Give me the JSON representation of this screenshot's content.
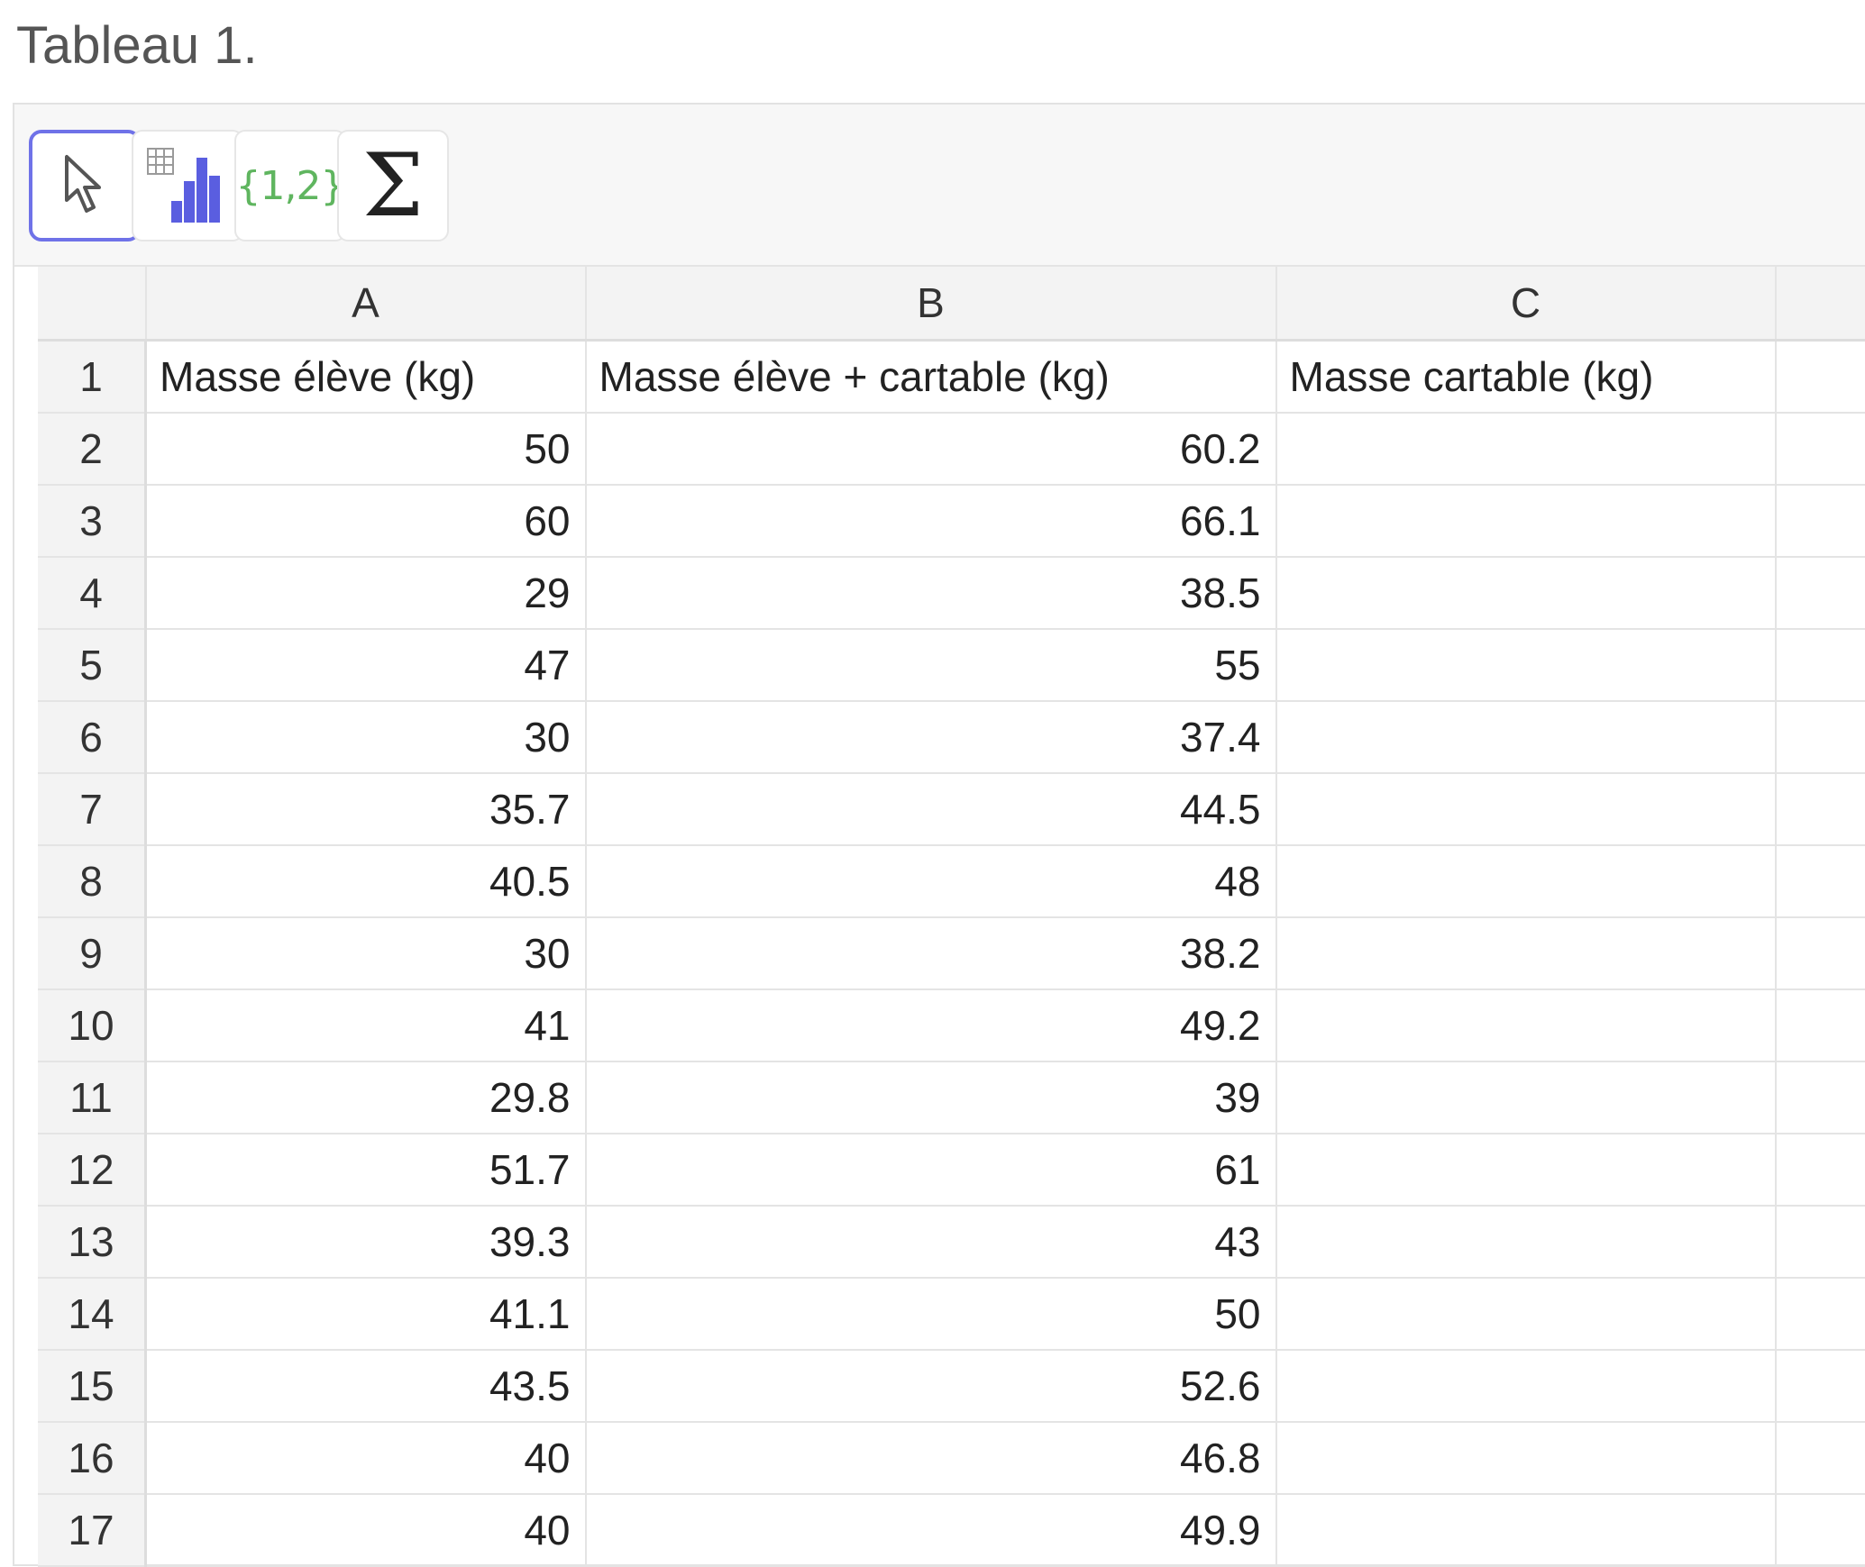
{
  "page_title": "Tableau 1.",
  "toolbar": {
    "tools": [
      {
        "name": "select",
        "icon": "cursor-arrow-icon",
        "active": true
      },
      {
        "name": "one-variable-analysis",
        "icon": "bar-chart-icon"
      },
      {
        "name": "create-list",
        "icon": "list-braces-icon",
        "label": "{1,2}"
      },
      {
        "name": "sum",
        "icon": "sigma-icon",
        "label": "Σ"
      }
    ]
  },
  "colors": {
    "active_tool_border": "#6f72e8",
    "bar_chart": "#5a5ee0",
    "list_label": "#5fb55f",
    "header_bg": "#f3f3f3",
    "grid_line": "#e4e4e4"
  },
  "spreadsheet": {
    "columns": [
      "A",
      "B",
      "C"
    ],
    "header_row": {
      "row": "1",
      "A": "Masse élève (kg)",
      "B": "Masse élève + cartable (kg)",
      "C": "Masse cartable (kg)"
    },
    "rows": [
      {
        "row": "2",
        "A": "50",
        "B": "60.2",
        "C": ""
      },
      {
        "row": "3",
        "A": "60",
        "B": "66.1",
        "C": ""
      },
      {
        "row": "4",
        "A": "29",
        "B": "38.5",
        "C": ""
      },
      {
        "row": "5",
        "A": "47",
        "B": "55",
        "C": ""
      },
      {
        "row": "6",
        "A": "30",
        "B": "37.4",
        "C": ""
      },
      {
        "row": "7",
        "A": "35.7",
        "B": "44.5",
        "C": ""
      },
      {
        "row": "8",
        "A": "40.5",
        "B": "48",
        "C": ""
      },
      {
        "row": "9",
        "A": "30",
        "B": "38.2",
        "C": ""
      },
      {
        "row": "10",
        "A": "41",
        "B": "49.2",
        "C": ""
      },
      {
        "row": "11",
        "A": "29.8",
        "B": "39",
        "C": ""
      },
      {
        "row": "12",
        "A": "51.7",
        "B": "61",
        "C": ""
      },
      {
        "row": "13",
        "A": "39.3",
        "B": "43",
        "C": ""
      },
      {
        "row": "14",
        "A": "41.1",
        "B": "50",
        "C": ""
      },
      {
        "row": "15",
        "A": "43.5",
        "B": "52.6",
        "C": ""
      },
      {
        "row": "16",
        "A": "40",
        "B": "46.8",
        "C": ""
      },
      {
        "row": "17",
        "A": "40",
        "B": "49.9",
        "C": ""
      }
    ]
  }
}
